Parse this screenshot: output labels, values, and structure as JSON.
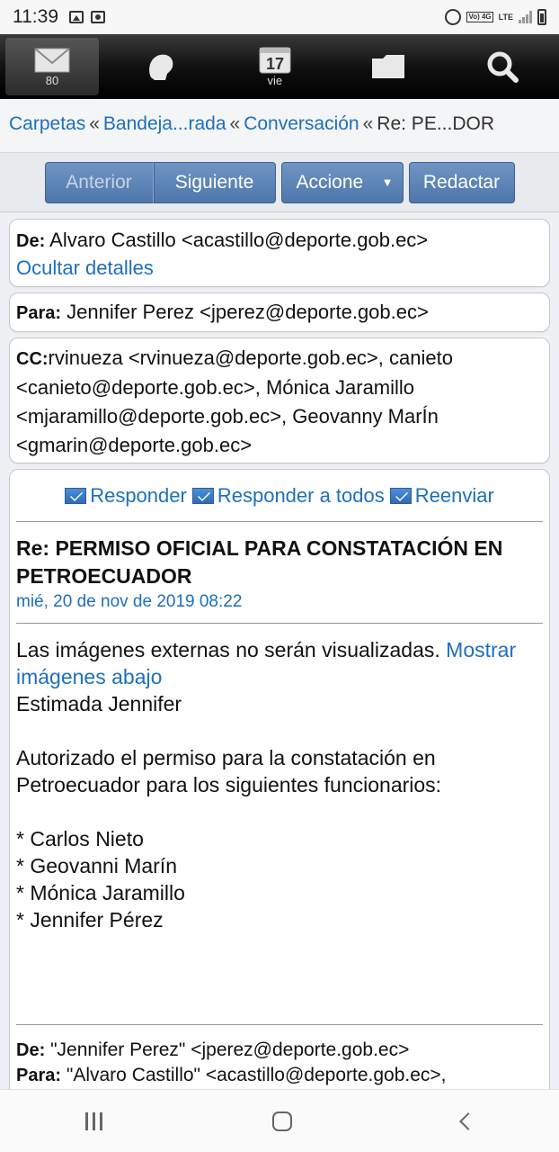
{
  "status_bar": {
    "time": "11:39",
    "network": "LTE",
    "volte": "Vo) 4G"
  },
  "top_nav": {
    "mail_count": "80",
    "calendar_day": "17",
    "calendar_label": "vie"
  },
  "breadcrumb": {
    "items": [
      "Carpetas",
      "Bandeja...rada",
      "Conversación",
      "Re: PE...DOR"
    ],
    "separator": "«"
  },
  "toolbar": {
    "previous": "Anterior",
    "next": "Siguiente",
    "actions": "Accione",
    "compose": "Redactar"
  },
  "header": {
    "from_label": "De:",
    "from_value": "Alvaro Castillo <acastillo@deporte.gob.ec>",
    "hide_details": "Ocultar detalles",
    "to_label": "Para:",
    "to_value": "Jennifer Perez <jperez@deporte.gob.ec>",
    "cc_label": "CC:",
    "cc_value": "rvinueza <rvinueza@deporte.gob.ec>, canieto <canieto@deporte.gob.ec>, Mónica Jaramillo <mjaramillo@deporte.gob.ec>, Geovanny MarÍn <gmarin@deporte.gob.ec>"
  },
  "message": {
    "reply": "Responder",
    "reply_all": "Responder a todos",
    "forward": "Reenviar",
    "subject": "Re: PERMISO OFICIAL PARA CONSTATACIÓN EN PETROECUADOR",
    "date": "mié, 20 de nov de 2019 08:22",
    "images_notice": "Las imágenes externas no serán visualizadas.",
    "show_images": "Mostrar imágenes abajo",
    "greeting": "Estimada Jennifer",
    "paragraph": "Autorizado el permiso para la constatación en Petroecuador para los siguientes funcionarios:",
    "list": [
      "* Carlos Nieto",
      "* Geovanni Marín",
      "* Mónica Jaramillo",
      "* Jennifer Pérez"
    ],
    "quoted_from_label": "De:",
    "quoted_from_value": "\"Jennifer Perez\" <jperez@deporte.gob.ec>",
    "quoted_to_label": "Para:",
    "quoted_to_value": "\"Alvaro Castillo\" <acastillo@deporte.gob.ec>,"
  },
  "colors": {
    "link": "#1d6fbd",
    "button": "#5a82b6",
    "nav_bg": "#111111"
  }
}
